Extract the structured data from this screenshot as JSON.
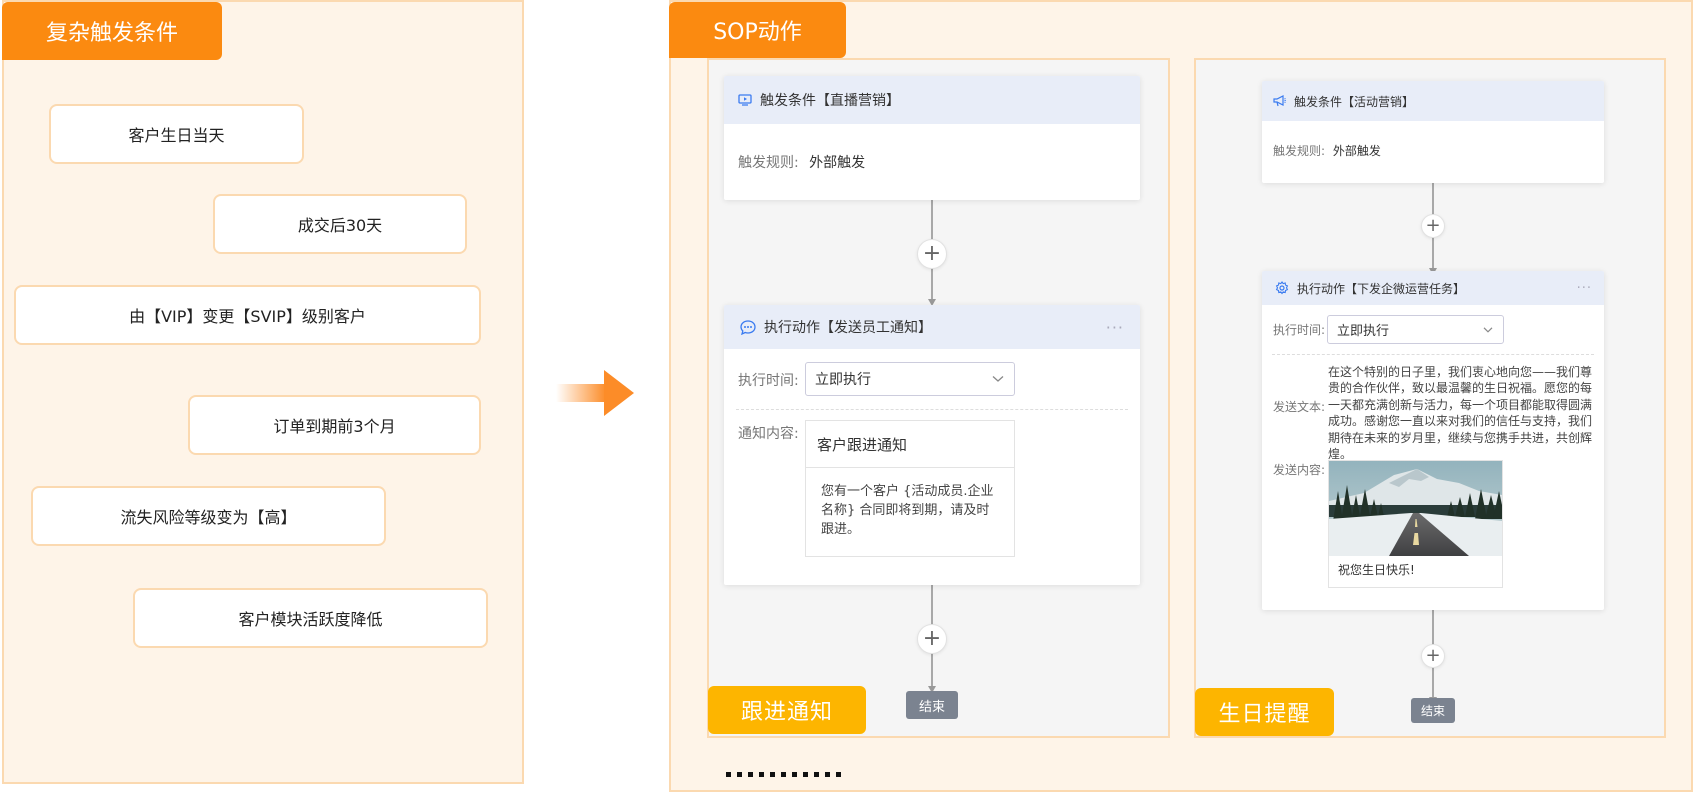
{
  "left": {
    "title": "复杂触发条件",
    "conditions": [
      "客户生日当天",
      "成交后30天",
      "由【VIP】变更【SVIP】级别客户",
      "订单到期前3个月",
      "流失风险等级变为【高】",
      "客户模块活跃度降低"
    ]
  },
  "right": {
    "title": "SOP动作",
    "ellipsis": "...........",
    "flow1": {
      "tag": "跟进通知",
      "trigger_title": "触发条件【直播营销】",
      "trigger_rule_label": "触发规则:",
      "trigger_rule_value": "外部触发",
      "action_title": "执行动作【发送员工通知】",
      "more": "···",
      "exec_time_label": "执行时间:",
      "exec_time_value": "立即执行",
      "notify_label": "通知内容:",
      "notify_title": "客户跟进通知",
      "notify_body": "您有一个客户 {活动成员.企业名称} 合同即将到期，请及时跟进。",
      "end": "结束",
      "plus": "+"
    },
    "flow2": {
      "tag": "生日提醒",
      "trigger_title": "触发条件【活动营销】",
      "trigger_rule_label": "触发规则:",
      "trigger_rule_value": "外部触发",
      "action_title": "执行动作【下发企微运营任务】",
      "more": "···",
      "exec_time_label": "执行时间:",
      "exec_time_value": "立即执行",
      "text_label": "发送文本:",
      "text_body": "在这个特别的日子里，我们衷心地向您——我们尊贵的合作伙伴，致以最温馨的生日祝福。愿您的每一天都充满创新与活力，每一个项目都能取得圆满成功。感谢您一直以来对我们的信任与支持，我们期待在未来的岁月里，继续与您携手共进，共创辉煌。",
      "content_label": "发送内容:",
      "image_caption": "祝您生日快乐!",
      "end": "结束",
      "plus": "+"
    }
  },
  "colors": {
    "orange": "#fb8a10",
    "yellow": "#fdb500",
    "panel_bg": "#fef4e8",
    "panel_border": "#fbd9b0",
    "card_head": "#e8edf8",
    "end_button": "#7b8390"
  }
}
